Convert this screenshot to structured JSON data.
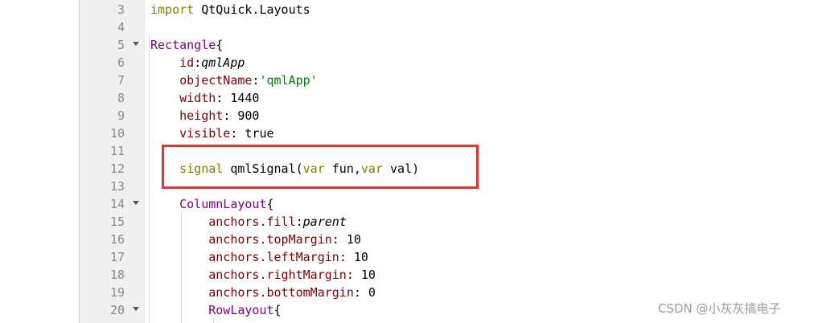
{
  "editor": {
    "lines": [
      {
        "num": "3",
        "fold": false,
        "tokens": [
          {
            "t": "import",
            "c": "kw"
          },
          {
            "t": " QtQuick.Layouts",
            "c": ""
          }
        ]
      },
      {
        "num": "4",
        "fold": false,
        "tokens": []
      },
      {
        "num": "5",
        "fold": true,
        "tokens": [
          {
            "t": "Rectangle",
            "c": "type"
          },
          {
            "t": "{",
            "c": ""
          }
        ]
      },
      {
        "num": "6",
        "fold": false,
        "tokens": [
          {
            "t": "    ",
            "c": ""
          },
          {
            "t": "id",
            "c": "prop"
          },
          {
            "t": ":",
            "c": ""
          },
          {
            "t": "qmlApp",
            "c": "it"
          }
        ]
      },
      {
        "num": "7",
        "fold": false,
        "tokens": [
          {
            "t": "    ",
            "c": ""
          },
          {
            "t": "objectName",
            "c": "prop"
          },
          {
            "t": ":",
            "c": ""
          },
          {
            "t": "'qmlApp'",
            "c": "str"
          }
        ]
      },
      {
        "num": "8",
        "fold": false,
        "tokens": [
          {
            "t": "    ",
            "c": ""
          },
          {
            "t": "width",
            "c": "prop"
          },
          {
            "t": ": 1440",
            "c": ""
          }
        ]
      },
      {
        "num": "9",
        "fold": false,
        "tokens": [
          {
            "t": "    ",
            "c": ""
          },
          {
            "t": "height",
            "c": "prop"
          },
          {
            "t": ": 900",
            "c": ""
          }
        ]
      },
      {
        "num": "10",
        "fold": false,
        "tokens": [
          {
            "t": "    ",
            "c": ""
          },
          {
            "t": "visible",
            "c": "prop"
          },
          {
            "t": ": true",
            "c": ""
          }
        ]
      },
      {
        "num": "11",
        "fold": false,
        "tokens": []
      },
      {
        "num": "12",
        "fold": false,
        "tokens": [
          {
            "t": "    ",
            "c": ""
          },
          {
            "t": "signal",
            "c": "kw"
          },
          {
            "t": " qmlSignal(",
            "c": ""
          },
          {
            "t": "var",
            "c": "kw"
          },
          {
            "t": " fun,",
            "c": ""
          },
          {
            "t": "var",
            "c": "kw"
          },
          {
            "t": " val)",
            "c": ""
          }
        ]
      },
      {
        "num": "13",
        "fold": false,
        "tokens": []
      },
      {
        "num": "14",
        "fold": true,
        "tokens": [
          {
            "t": "    ",
            "c": ""
          },
          {
            "t": "ColumnLayout",
            "c": "type"
          },
          {
            "t": "{",
            "c": ""
          }
        ]
      },
      {
        "num": "15",
        "fold": false,
        "tokens": [
          {
            "t": "        ",
            "c": ""
          },
          {
            "t": "anchors.fill",
            "c": "prop"
          },
          {
            "t": ":",
            "c": ""
          },
          {
            "t": "parent",
            "c": "it"
          }
        ]
      },
      {
        "num": "16",
        "fold": false,
        "tokens": [
          {
            "t": "        ",
            "c": ""
          },
          {
            "t": "anchors.topMargin",
            "c": "prop"
          },
          {
            "t": ": 10",
            "c": ""
          }
        ]
      },
      {
        "num": "17",
        "fold": false,
        "tokens": [
          {
            "t": "        ",
            "c": ""
          },
          {
            "t": "anchors.leftMargin",
            "c": "prop"
          },
          {
            "t": ": 10",
            "c": ""
          }
        ]
      },
      {
        "num": "18",
        "fold": false,
        "tokens": [
          {
            "t": "        ",
            "c": ""
          },
          {
            "t": "anchors.rightMargin",
            "c": "prop"
          },
          {
            "t": ": 10",
            "c": ""
          }
        ]
      },
      {
        "num": "19",
        "fold": false,
        "tokens": [
          {
            "t": "        ",
            "c": ""
          },
          {
            "t": "anchors.bottomMargin",
            "c": "prop"
          },
          {
            "t": ": 0",
            "c": ""
          }
        ]
      },
      {
        "num": "20",
        "fold": true,
        "tokens": [
          {
            "t": "        ",
            "c": ""
          },
          {
            "t": "RowLayout",
            "c": "type"
          },
          {
            "t": "{",
            "c": ""
          }
        ]
      }
    ]
  },
  "watermark": "CSDN @小灰灰搞电子",
  "colors": {
    "highlight": "#e8322a",
    "keyword": "#808000",
    "type": "#800080",
    "property": "#800000",
    "string": "#008000"
  }
}
